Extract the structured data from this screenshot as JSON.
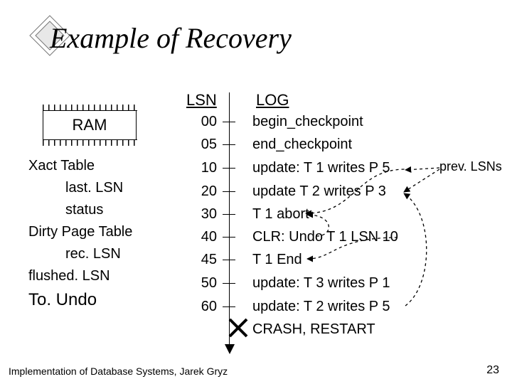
{
  "title": "Example of Recovery",
  "headers": {
    "lsn": "LSN",
    "log": "LOG"
  },
  "log": [
    {
      "lsn": "00",
      "event": "begin_checkpoint"
    },
    {
      "lsn": "05",
      "event": "end_checkpoint"
    },
    {
      "lsn": "10",
      "event": "update: T 1 writes P 5"
    },
    {
      "lsn": "20",
      "event": "update T 2 writes P 3"
    },
    {
      "lsn": "30",
      "event": "T 1 abort"
    },
    {
      "lsn": "40",
      "event": "CLR: Undo T 1 LSN 10"
    },
    {
      "lsn": "45",
      "event": "T 1 End"
    },
    {
      "lsn": "50",
      "event": "update: T 3 writes P 1"
    },
    {
      "lsn": "60",
      "event": "update: T 2 writes P 5"
    }
  ],
  "crash": "CRASH, RESTART",
  "ram": {
    "label": "RAM"
  },
  "side": {
    "xact_table": "Xact Table",
    "lastLSN": "last. LSN",
    "status": "status",
    "dpt": "Dirty Page Table",
    "recLSN": "rec. LSN",
    "flushedLSN": "flushed. LSN"
  },
  "toundo": "To. Undo",
  "prev_label": "prev. LSNs",
  "footer": {
    "left": "Implementation of Database Systems, Jarek Gryz",
    "right": "23"
  }
}
